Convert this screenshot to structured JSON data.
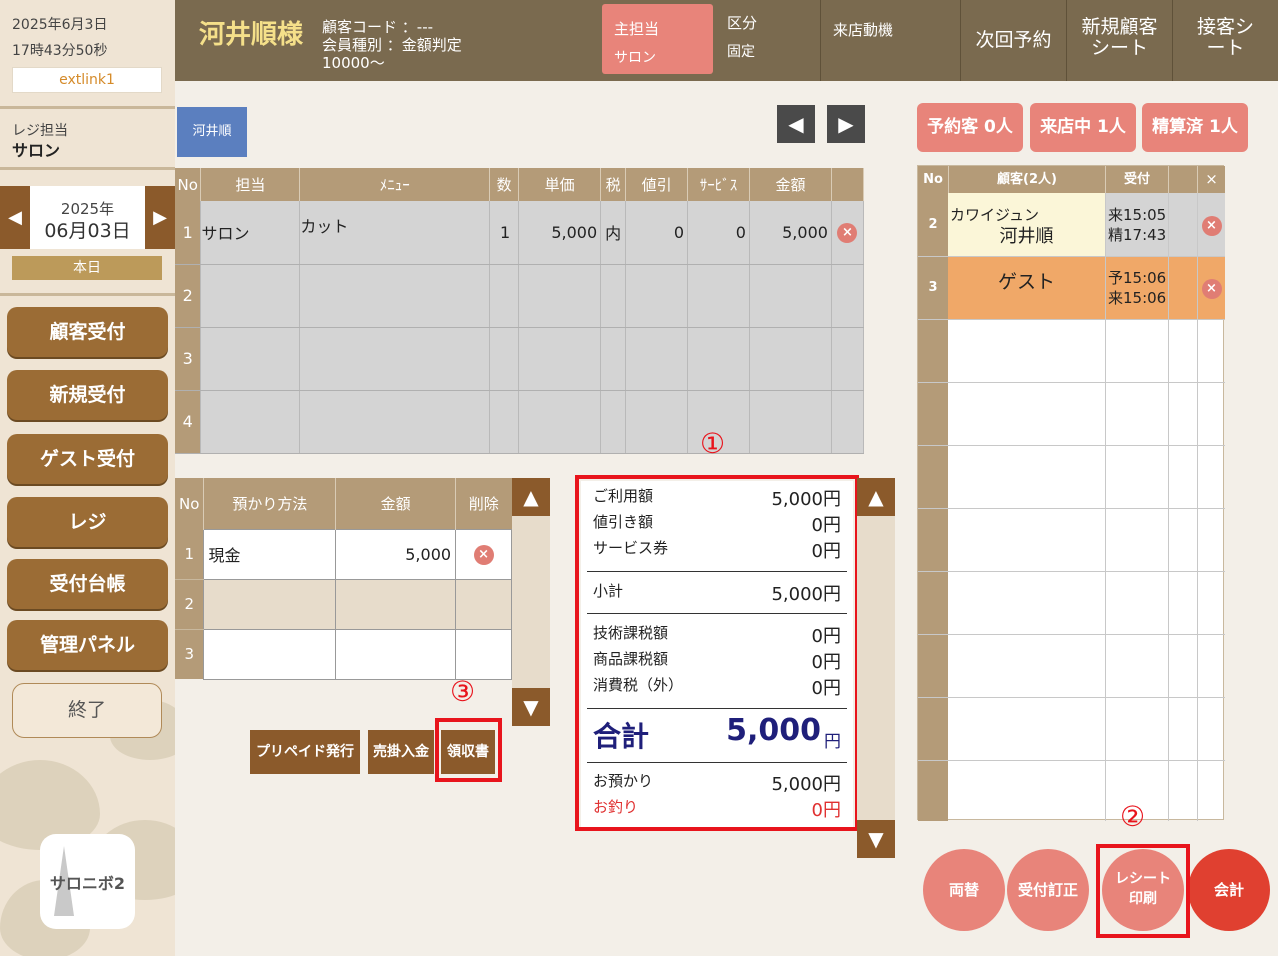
{
  "sidebar": {
    "date": "2025年6月3日",
    "time": "17時43分50秒",
    "extlink": "extlink1",
    "register_label": "レジ担当",
    "register_name": "サロン",
    "cal_year": "2025年",
    "cal_day": "06月03日",
    "today": "本日",
    "nav": [
      "顧客受付",
      "新規受付",
      "ゲスト受付",
      "レジ",
      "受付台帳",
      "管理パネル"
    ],
    "end": "終了",
    "logo": "サロニボ2"
  },
  "header": {
    "customer": "河井順様",
    "code_label": "顧客コード",
    "code_value": "---",
    "member_label": "会員種別",
    "member_value": "金額判定",
    "member_extra": "10000～",
    "main_staff": "主担当",
    "main_staff_value": "サロン",
    "category": "区分",
    "category_value": "固定",
    "motive": "来店動機",
    "next": "次回予約",
    "new_sheet": "新規顧客シート",
    "service_sheet": "接客シート"
  },
  "staff_tab": "河井順",
  "menu_table": {
    "headers": [
      "No",
      "担当",
      "ﾒﾆｭｰ",
      "数",
      "単価",
      "税",
      "値引",
      "ｻｰﾋﾞｽ",
      "金額",
      ""
    ],
    "rows": [
      {
        "no": "1",
        "staff": "サロン",
        "menu": "カット",
        "qty": "1",
        "price": "5,000",
        "tax": "内",
        "disc": "0",
        "svc": "0",
        "amount": "5,000"
      },
      {
        "no": "2",
        "staff": "",
        "menu": "",
        "qty": "",
        "price": "",
        "tax": "",
        "disc": "",
        "svc": "",
        "amount": ""
      },
      {
        "no": "3",
        "staff": "",
        "menu": "",
        "qty": "",
        "price": "",
        "tax": "",
        "disc": "",
        "svc": "",
        "amount": ""
      },
      {
        "no": "4",
        "staff": "",
        "menu": "",
        "qty": "",
        "price": "",
        "tax": "",
        "disc": "",
        "svc": "",
        "amount": ""
      }
    ]
  },
  "pay_table": {
    "headers": [
      "No",
      "預かり方法",
      "金額",
      "削除"
    ],
    "rows": [
      {
        "no": "1",
        "method": "現金",
        "amount": "5,000"
      },
      {
        "no": "2",
        "method": "",
        "amount": ""
      },
      {
        "no": "3",
        "method": "",
        "amount": ""
      }
    ]
  },
  "summary": {
    "use_label": "ご利用額",
    "use": "5,000円",
    "disc_label": "値引き額",
    "disc": "0円",
    "svc_label": "サービス券",
    "svc": "0円",
    "sub_label": "小計",
    "sub": "5,000円",
    "tech_label": "技術課税額",
    "tech": "0円",
    "prod_label": "商品課税額",
    "prod": "0円",
    "tax_label": "消費税（外）",
    "tax": "0円",
    "total_label": "合計",
    "total": "5,000",
    "total_unit": "円",
    "recv_label": "お預かり",
    "recv": "5,000円",
    "change_label": "お釣り",
    "change": "0円"
  },
  "actions": {
    "prepaid": "プリペイド発行",
    "credit": "売掛入金",
    "receipt": "領収書"
  },
  "status": {
    "reserved": "予約客 0人",
    "visiting": "来店中 1人",
    "settled": "精算済 1人"
  },
  "queue_table": {
    "headers": [
      "No",
      "顧客(2人)",
      "受付",
      "",
      "×"
    ],
    "rows": [
      {
        "no": "2",
        "kana": "カワイジュン",
        "name": "河井順",
        "t1": "来15:05",
        "t2": "精17:43"
      },
      {
        "no": "3",
        "kana": "",
        "name": "ゲスト",
        "t1": "予15:06",
        "t2": "来15:06"
      }
    ]
  },
  "bottom": {
    "exchange": "両替",
    "reception_fix": "受付訂正",
    "receipt_print": "レシート印刷",
    "checkout": "会計"
  },
  "annotations": [
    "①",
    "②",
    "③"
  ],
  "colors": {
    "brown": "#8b5a2b",
    "header": "#7a6a4f",
    "accent_pink": "#e8847a",
    "red": "#e8141c",
    "navy": "#1f1f7a"
  }
}
